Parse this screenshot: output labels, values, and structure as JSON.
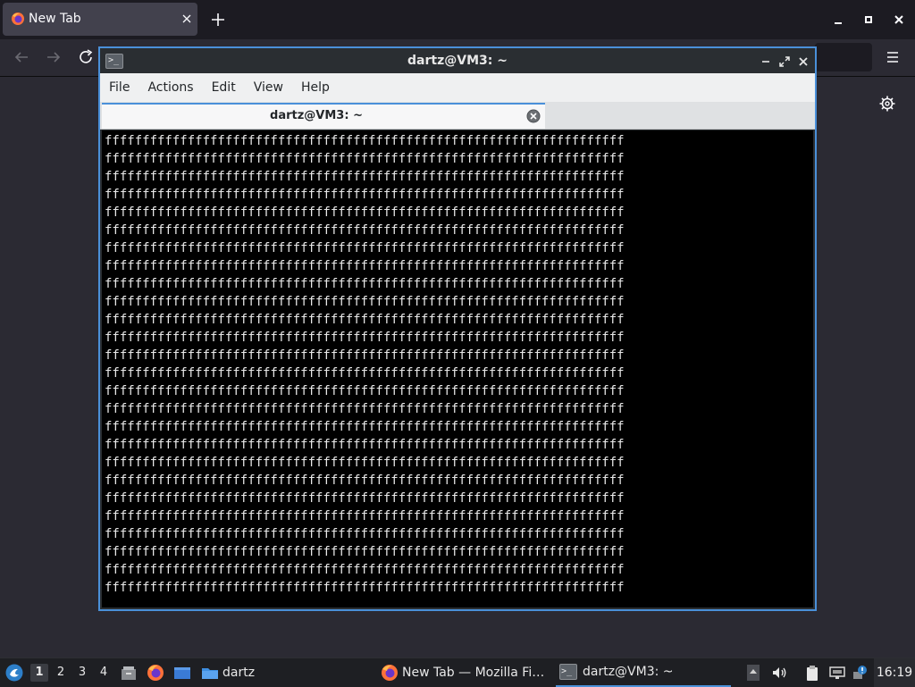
{
  "firefox": {
    "tab_title": "New Tab",
    "new_tab_label": "+",
    "window_controls": [
      "minimize",
      "maximize",
      "close"
    ],
    "nav_icons": [
      "back-arrow-icon",
      "forward-arrow-icon",
      "reload-icon"
    ],
    "menu_icon": "hamburger-menu-icon",
    "settings_icon": "gear-icon"
  },
  "terminal": {
    "title": "dartz@VM3: ~",
    "menu": [
      "File",
      "Actions",
      "Edit",
      "View",
      "Help"
    ],
    "tab_label": "dartz@VM3: ~",
    "accent": "#4a90d9",
    "line_text": "fffffffffffffffffffffffffffffffffffffffffffffffffffffffffffffffffffff",
    "line_count": 26
  },
  "taskbar": {
    "workspaces": [
      "1",
      "2",
      "3",
      "4"
    ],
    "active_workspace": "1",
    "folder_label": "dartz",
    "firefox_task_label": "New Tab — Mozilla Fi…",
    "terminal_task_label": "dartz@VM3: ~",
    "clock": "16:19"
  }
}
